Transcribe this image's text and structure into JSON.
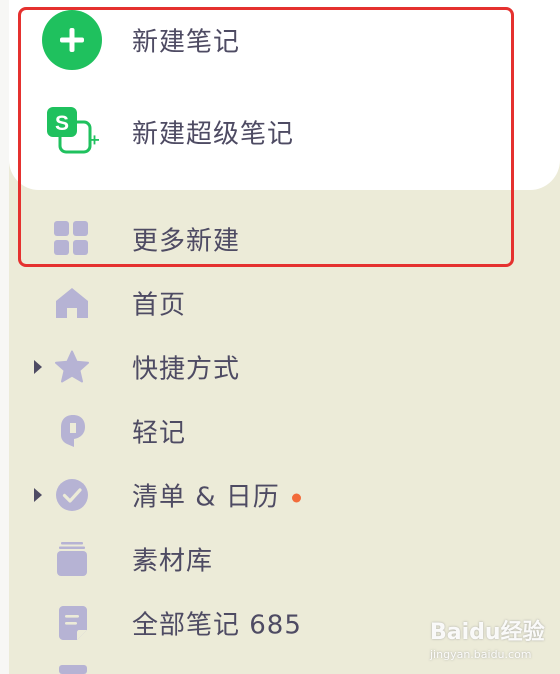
{
  "create_menu": {
    "new_note": "新建笔记",
    "new_super_note": "新建超级笔记",
    "super_icon_letter": "S"
  },
  "nav": {
    "more_new": "更多新建",
    "home": "首页",
    "shortcuts": "快捷方式",
    "quick_note": "轻记",
    "lists_calendar": "清单 & 日历",
    "materials": "素材库",
    "all_notes": "全部笔记 685"
  },
  "watermark": {
    "text": "Baidu经验",
    "sub": "jingyan.baidu.com"
  },
  "colors": {
    "accent_green": "#1fc15e",
    "sidebar_bg": "#ecebd8",
    "icon_purple": "#b6b3d4",
    "highlight_red": "#e5312f",
    "notify_dot": "#f26b3a"
  }
}
